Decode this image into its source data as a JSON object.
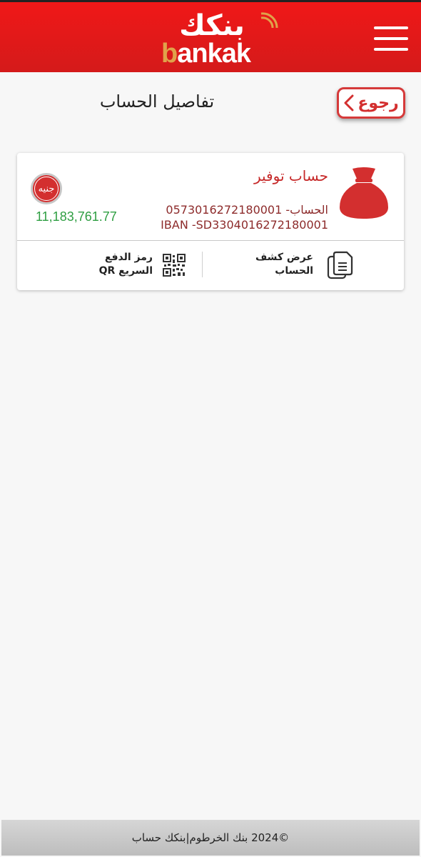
{
  "header": {
    "logo_arabic": "بنكك",
    "logo_english_first": "b",
    "logo_english_rest": "ankak",
    "accent_color": "#e31b1b",
    "logo_gold": "#e0a24a"
  },
  "navigation": {
    "back_label": "رجوع",
    "back_icon": "chevron-left-icon",
    "menu_icon": "hamburger-menu-icon"
  },
  "page": {
    "title": "تفاصيل الحساب"
  },
  "account": {
    "type": "حساب توفير",
    "number_line": "الحساب- 0573016272180001",
    "iban_line": "IBAN -SD3304016272180001",
    "currency": "جنيه",
    "balance": "11,183,761.77",
    "balance_color": "#2e9e42",
    "icon": "money-bag-icon"
  },
  "actions": {
    "statement_label": "عرض كشف الحساب",
    "statement_icon": "document-copy-icon",
    "qr_label": "رمز الدفع السريع QR",
    "qr_icon": "qr-code-icon"
  },
  "footer": {
    "text": "©2024 بنك الخرطوم|بنكك حساب"
  }
}
